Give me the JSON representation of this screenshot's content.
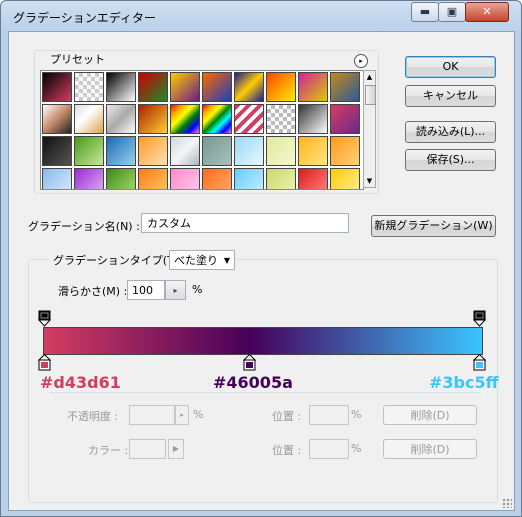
{
  "window": {
    "title": "グラデーションエディター",
    "caption_buttons": {
      "minimize": "▬",
      "maximize": "▣",
      "close": "✕"
    }
  },
  "presets": {
    "label": "プリセット",
    "menu_icon": "▸",
    "swatches": [
      [
        "linear-gradient(135deg,#000,#d43d61)",
        "repeating-conic-gradient(#ccc 0 25%,#fff 0 50%) 0 0/8px 8px",
        "linear-gradient(135deg,#000,#fff)",
        "linear-gradient(135deg,#c00,#1e8a2e)",
        "linear-gradient(135deg,#ffcc00,#6a1a8a)",
        "linear-gradient(135deg,#ff6600,#1a3fbf)",
        "linear-gradient(135deg,#1a1a99,#ffcc00 50%,#1a1a99)",
        "linear-gradient(135deg,#ff4400,#ffee00)",
        "linear-gradient(135deg,#cc2299,#ddcc00)",
        "linear-gradient(135deg,#c48a1a,#2b5a9a)"
      ],
      [
        "linear-gradient(135deg,#fff,#c48a6a,#222)",
        "linear-gradient(135deg,#ddd,#fff 40%,#d9a34a)",
        "linear-gradient(135deg,#e8e8e8,#aaa 50%,#fff)",
        "linear-gradient(135deg,#aa2200,#ffcc33)",
        "linear-gradient(135deg,red,orange,yellow,green,blue,violet)",
        "linear-gradient(135deg,red,orange,yellow,green,cyan,blue,violet)",
        "repeating-linear-gradient(135deg,#d43d61 0 4px,#fff 4px 8px)",
        "repeating-conic-gradient(#bbb 0 25%,#fff 0 50%) 0 0/8px 8px",
        "linear-gradient(135deg,#333,#fff)",
        "linear-gradient(135deg,#d43d61,#6a2a8a)"
      ],
      [
        "linear-gradient(135deg,#111,#555)",
        "linear-gradient(135deg,#4a9a1a,#c6e89a)",
        "linear-gradient(135deg,#1a6ab0,#9ad0f0)",
        "linear-gradient(135deg,#ff9a2a,#ffe0b0)",
        "linear-gradient(135deg,#cfd6de,#f4f6f8,#aab4be)",
        "linear-gradient(135deg,#7a9a94,#a8c0bc)",
        "linear-gradient(135deg,#9ad8f4,#e8f8ff)",
        "linear-gradient(135deg,#dfe89a,#f4f8d0)",
        "linear-gradient(135deg,#ffb41a,#ffe680)",
        "linear-gradient(135deg,#ff9a1a,#ffd27a)"
      ],
      [
        "linear-gradient(135deg,#8ab8e8,#dceeff)",
        "linear-gradient(135deg,#9a2ad4,#e0b8f4)",
        "linear-gradient(135deg,#3a8a1a,#b0e070)",
        "linear-gradient(135deg,#ff7a1a,#ffcc66)",
        "linear-gradient(135deg,#ff88cc,#ffd0ec)",
        "linear-gradient(135deg,#ff6a1a,#ffb070)",
        "linear-gradient(135deg,#66ccff,#d0f0ff)",
        "linear-gradient(135deg,#c8d870,#eef4b0)",
        "linear-gradient(135deg,#e01a1a,#ff8a8a)",
        "linear-gradient(135deg,#ffcc00,#fff0a0)"
      ]
    ]
  },
  "buttons": {
    "ok": "OK",
    "cancel": "キャンセル",
    "load": "読み込み(L)...",
    "save": "保存(S)...",
    "new_gradient": "新規グラデーション(W)"
  },
  "name": {
    "label": "グラデーション名(N) :",
    "value": "カスタム"
  },
  "gradient": {
    "type_label": "グラデーションタイプ(T) :",
    "type_value": "べた塗り",
    "type_arrow": "▼",
    "smoothness_label": "滑らかさ(M) :",
    "smoothness_value": "100",
    "smoothness_stepper": "▸",
    "smoothness_unit": "%",
    "color_stops": [
      "#d43d61",
      "#46005a",
      "#3bc5ff"
    ],
    "hex_labels": {
      "left": "#d43d61",
      "mid": "#46005a",
      "right": "#3bc5ff"
    }
  },
  "stops": {
    "opacity_label": "不透明度 :",
    "opacity_stepper": "▸",
    "opacity_unit": "%",
    "location_label_1": "位置 :",
    "location_unit_1": "%",
    "delete_1": "削除(D)",
    "color_label": "カラー :",
    "color_arrow": "▶",
    "location_label_2": "位置 :",
    "location_unit_2": "%",
    "delete_2": "削除(D)"
  }
}
